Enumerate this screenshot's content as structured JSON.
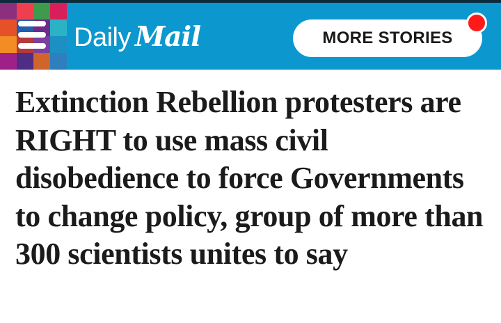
{
  "header": {
    "logo_daily": "Daily",
    "logo_mail": "Mail",
    "more_stories_label": "MORE STORIES",
    "menu_icon": "hamburger-menu-icon",
    "brand_color": "#0c98cf",
    "notification_color": "#ff1a1a"
  },
  "article": {
    "headline": "Extinction Rebellion protesters are RIGHT to use mass civil disobedience to force Governments to change policy, group of more than 300 scientists unites to say"
  }
}
